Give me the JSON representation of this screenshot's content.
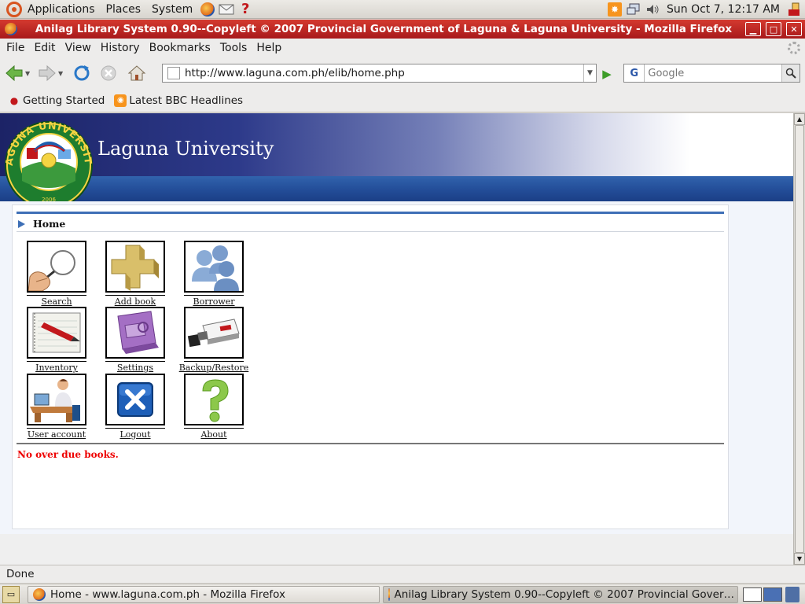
{
  "top_panel": {
    "menus": [
      "Applications",
      "Places",
      "System"
    ],
    "launchers": [
      "firefox-icon",
      "mail-icon",
      "help-icon"
    ],
    "clock": "Sun Oct  7, 12:17 AM"
  },
  "window": {
    "title": "Anilag Library System 0.90--Copyleft © 2007 Provincial Government of Laguna & Laguna University - Mozilla Firefox"
  },
  "menubar": [
    "File",
    "Edit",
    "View",
    "History",
    "Bookmarks",
    "Tools",
    "Help"
  ],
  "navbar": {
    "url": "http://www.laguna.com.ph/elib/home.php",
    "search_placeholder": "Google",
    "search_engine_letter": "G"
  },
  "bookmarks": [
    "Getting Started",
    "Latest BBC Headlines"
  ],
  "page": {
    "site_title": "Laguna University",
    "logo": {
      "top_text": "LAGUNA UNIVERSITY",
      "year": "2006"
    },
    "section": "Home",
    "tiles": [
      {
        "label": "Search",
        "icon": "magnifier-icon"
      },
      {
        "label": "Add book",
        "icon": "add-book-icon"
      },
      {
        "label": "Borrower",
        "icon": "people-icon"
      },
      {
        "label": "Inventory",
        "icon": "notebook-icon"
      },
      {
        "label": "Settings",
        "icon": "settings-icon"
      },
      {
        "label": "Backup/Restore",
        "icon": "usb-drive-icon"
      },
      {
        "label": "User account",
        "icon": "user-account-icon"
      },
      {
        "label": "Logout",
        "icon": "logout-icon"
      },
      {
        "label": "About",
        "icon": "question-mark-icon"
      }
    ],
    "overdue_message": "No over due books."
  },
  "status": "Done",
  "taskbar": [
    {
      "label": "Home - www.laguna.com.ph - Mozilla Firefox",
      "active": false
    },
    {
      "label": "Anilag Library System 0.90--Copyleft © 2007 Provincial Gover…",
      "active": true
    }
  ],
  "colors": {
    "titlebar": "#c02a27",
    "banner_dark": "#1c2366",
    "banner_bar": "#2a58a3",
    "overdue_red": "#e00000"
  }
}
